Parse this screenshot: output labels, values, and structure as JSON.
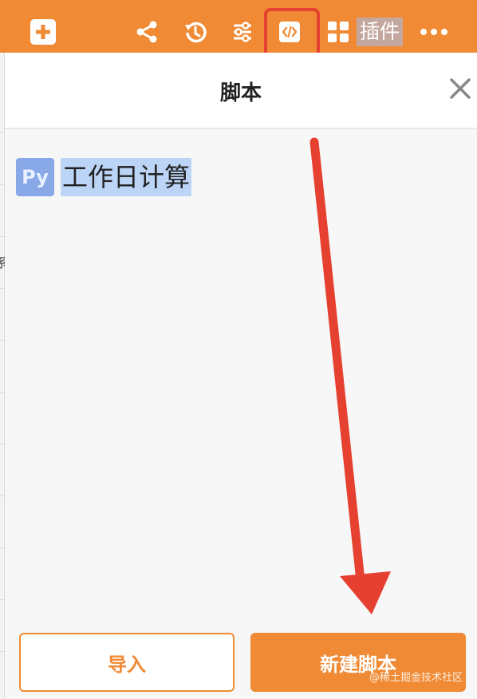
{
  "toolbar": {
    "background": "#f08a34",
    "icons": {
      "add": "plus-icon",
      "share": "share-icon",
      "history": "history-icon",
      "settings": "sliders-icon",
      "script": "code-icon",
      "plugins": "grid-icon",
      "more": "more-icon"
    },
    "plugins_label": "插件"
  },
  "highlight_color": "#e64030",
  "panel": {
    "title": "脚本",
    "close_icon": "close-icon",
    "scripts": [
      {
        "badge": "Py",
        "name": "工作日计算"
      }
    ]
  },
  "buttons": {
    "import_label": "导入",
    "new_script_label": "新建脚本"
  },
  "left_fragment": "系",
  "watermark": "@稀土掘金技术社区",
  "accent": "#f08a34"
}
